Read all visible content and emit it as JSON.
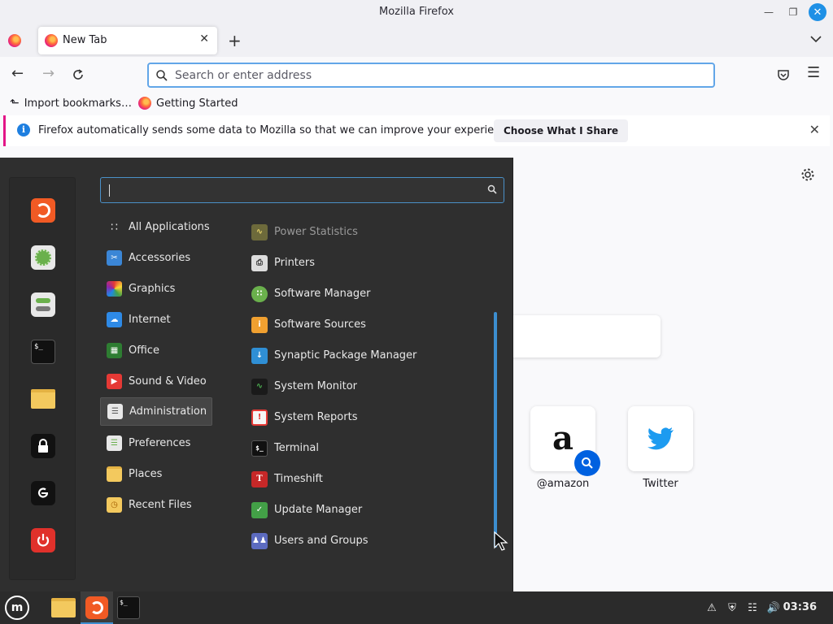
{
  "window": {
    "title": "Mozilla Firefox"
  },
  "tabs": [
    {
      "label": "New Tab"
    }
  ],
  "urlbar": {
    "placeholder": "Search or enter address"
  },
  "bookmarks": [
    {
      "label": "Import bookmarks…"
    },
    {
      "label": "Getting Started"
    }
  ],
  "infobar": {
    "message": "Firefox automatically sends some data to Mozilla so that we can improve your experience.",
    "button": "Choose What I Share"
  },
  "shortcuts": [
    {
      "label": "@amazon"
    },
    {
      "label": "Twitter"
    }
  ],
  "menu": {
    "search_value": "",
    "favorites": [
      "firefox-icon",
      "software-manager-icon",
      "settings-icon",
      "terminal-icon",
      "files-icon",
      "lock-icon",
      "logout-icon",
      "power-icon"
    ],
    "categories": [
      {
        "label": "All Applications"
      },
      {
        "label": "Accessories"
      },
      {
        "label": "Graphics"
      },
      {
        "label": "Internet"
      },
      {
        "label": "Office"
      },
      {
        "label": "Sound & Video"
      },
      {
        "label": "Administration",
        "selected": true
      },
      {
        "label": "Preferences"
      },
      {
        "label": "Places"
      },
      {
        "label": "Recent Files"
      }
    ],
    "apps": [
      {
        "label": "Power Statistics",
        "dimmed": true
      },
      {
        "label": "Printers"
      },
      {
        "label": "Software Manager"
      },
      {
        "label": "Software Sources"
      },
      {
        "label": "Synaptic Package Manager"
      },
      {
        "label": "System Monitor"
      },
      {
        "label": "System Reports"
      },
      {
        "label": "Terminal"
      },
      {
        "label": "Timeshift"
      },
      {
        "label": "Update Manager"
      },
      {
        "label": "Users and Groups"
      }
    ]
  },
  "taskbar": {
    "clock": "03:36"
  },
  "colors": {
    "accent": "#3c8ed0",
    "menu_bg": "#2f2f2f",
    "firefox_orange": "#ff7139"
  }
}
